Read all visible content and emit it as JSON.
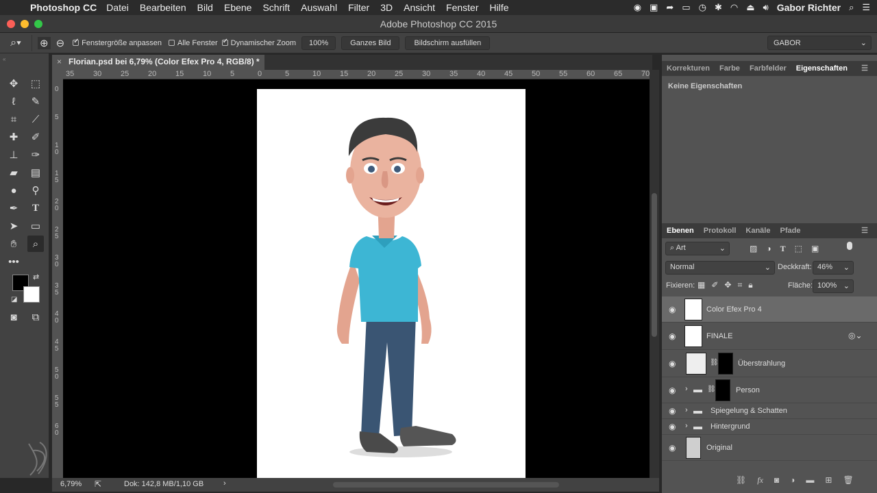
{
  "menubar": {
    "apple_icon": "apple-logo",
    "app_name": "Photoshop CC",
    "items": [
      "Datei",
      "Bearbeiten",
      "Bild",
      "Ebene",
      "Schrift",
      "Auswahl",
      "Filter",
      "3D",
      "Ansicht",
      "Fenster",
      "Hilfe"
    ],
    "user": "Gabor Richter"
  },
  "window": {
    "title": "Adobe Photoshop CC 2015"
  },
  "options": {
    "fit_window": "Fenstergröße anpassen",
    "all_windows": "Alle Fenster",
    "dynamic_zoom": "Dynamischer Zoom",
    "zoom_value": "100%",
    "whole_image": "Ganzes Bild",
    "fill_screen": "Bildschirm ausfüllen",
    "workspace": "GABOR"
  },
  "document": {
    "tab_title": "Florian.psd bei 6,79% (Color Efex Pro 4, RGB/8) *",
    "ruler_top": [
      "35",
      "30",
      "25",
      "20",
      "15",
      "10",
      "5",
      "0",
      "5",
      "10",
      "15",
      "20",
      "25",
      "30",
      "35",
      "40",
      "45",
      "50",
      "55",
      "60",
      "65",
      "70"
    ],
    "ruler_left": [
      "0",
      "5",
      "10",
      "15",
      "20",
      "25",
      "30",
      "35",
      "40",
      "45",
      "50",
      "55",
      "60"
    ]
  },
  "status": {
    "zoom": "6,79%",
    "doc_info": "Dok: 142,8 MB/1,10 GB"
  },
  "properties_panel": {
    "tabs": [
      "Korrekturen",
      "Farbe",
      "Farbfelder",
      "Eigenschaften"
    ],
    "active_tab": "Eigenschaften",
    "content": "Keine Eigenschaften"
  },
  "layers_panel": {
    "tabs": [
      "Ebenen",
      "Protokoll",
      "Kanäle",
      "Pfade"
    ],
    "active_tab": "Ebenen",
    "filter_kind": "Art",
    "blend_mode": "Normal",
    "opacity_label": "Deckkraft:",
    "opacity_value": "46%",
    "lock_label": "Fixieren:",
    "fill_label": "Fläche:",
    "fill_value": "100%",
    "layers": [
      {
        "name": "Color Efex Pro 4"
      },
      {
        "name": "FINALE"
      },
      {
        "name": "Überstrahlung"
      },
      {
        "name": "Person"
      },
      {
        "name": "Spiegelung & Schatten"
      },
      {
        "name": "Hintergrund"
      },
      {
        "name": "Original"
      }
    ]
  }
}
